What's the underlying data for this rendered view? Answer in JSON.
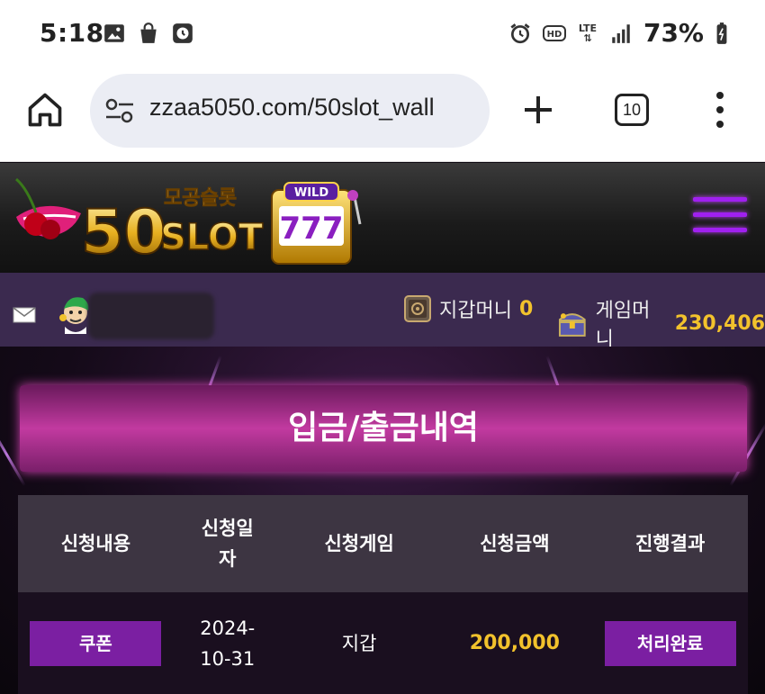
{
  "status_bar": {
    "time": "5:18",
    "network": "LTE",
    "battery": "73%",
    "icons_left": [
      "image-icon",
      "shopping-bag-icon",
      "clock-app-icon"
    ],
    "icons_right": [
      "alarm-icon",
      "hd-icon",
      "lte-icon",
      "signal-icon",
      "battery-icon"
    ]
  },
  "browser": {
    "url": "zzaa5050.com/50slot_wall",
    "tab_count": "10"
  },
  "header": {
    "logo_text": "50SLOT",
    "logo_subtext": "모공슬롯",
    "logo_badge": "WILD"
  },
  "userbar": {
    "wallet_label": "지갑머니",
    "wallet_value": "0",
    "game_label": "게임머니",
    "game_value": "230,406"
  },
  "page": {
    "title": "입금/출금내역"
  },
  "table": {
    "headers": [
      "신청내용",
      "신청일자",
      "신청게임",
      "신청금액",
      "진행결과"
    ],
    "rows": [
      {
        "type": "쿠폰",
        "date": "2024-10-31",
        "game": "지갑",
        "amount": "200,000",
        "status": "처리완료"
      }
    ]
  },
  "colors": {
    "accent_purple": "#7b1fa2",
    "gold": "#f2c22c",
    "banner_pink": "#c23aa0",
    "userbar_bg": "#3b2a4f"
  }
}
